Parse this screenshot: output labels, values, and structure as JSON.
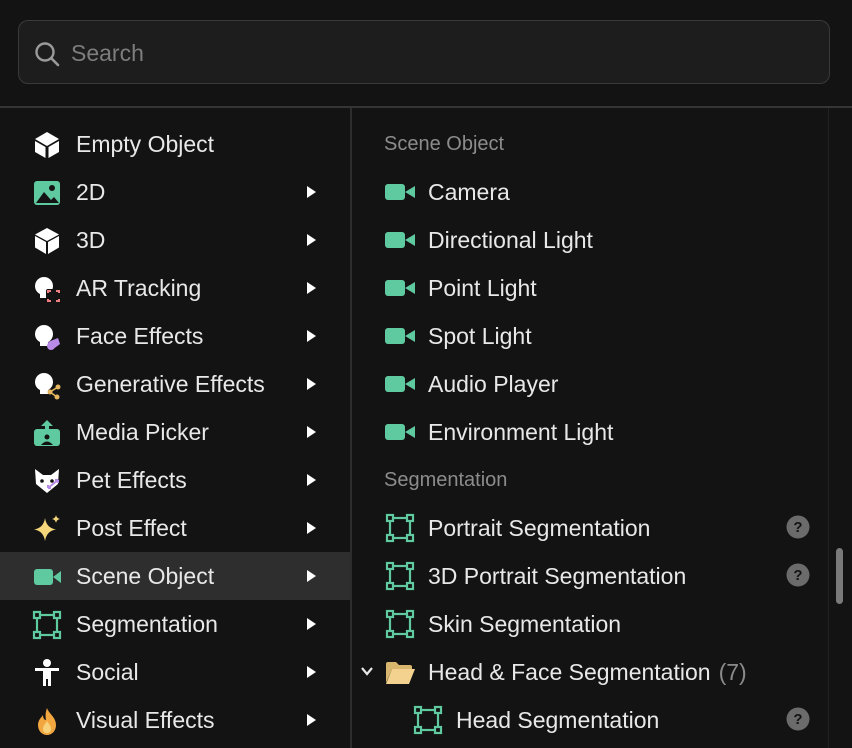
{
  "search": {
    "placeholder": "Search",
    "value": ""
  },
  "left_menu": {
    "items": [
      {
        "label": "Empty Object",
        "icon": "empty-object-icon",
        "has_submenu": false,
        "active": false
      },
      {
        "label": "2D",
        "icon": "image-icon",
        "has_submenu": true,
        "active": false
      },
      {
        "label": "3D",
        "icon": "cube-icon",
        "has_submenu": true,
        "active": false
      },
      {
        "label": "AR Tracking",
        "icon": "ar-tracking-icon",
        "has_submenu": true,
        "active": false
      },
      {
        "label": "Face Effects",
        "icon": "face-effects-icon",
        "has_submenu": true,
        "active": false
      },
      {
        "label": "Generative Effects",
        "icon": "generative-effects-icon",
        "has_submenu": true,
        "active": false
      },
      {
        "label": "Media Picker",
        "icon": "media-picker-icon",
        "has_submenu": true,
        "active": false
      },
      {
        "label": "Pet Effects",
        "icon": "pet-effects-icon",
        "has_submenu": true,
        "active": false
      },
      {
        "label": "Post Effect",
        "icon": "sparkle-icon",
        "has_submenu": true,
        "active": false
      },
      {
        "label": "Scene Object",
        "icon": "video-camera-icon",
        "has_submenu": true,
        "active": true
      },
      {
        "label": "Segmentation",
        "icon": "segmentation-icon",
        "has_submenu": true,
        "active": false
      },
      {
        "label": "Social",
        "icon": "person-icon",
        "has_submenu": true,
        "active": false
      },
      {
        "label": "Visual Effects",
        "icon": "flame-icon",
        "has_submenu": true,
        "active": false
      }
    ]
  },
  "right_panel": {
    "scene_object": {
      "header": "Scene Object",
      "items": [
        {
          "label": "Camera",
          "icon": "video-camera-icon"
        },
        {
          "label": "Directional Light",
          "icon": "video-camera-icon"
        },
        {
          "label": "Point Light",
          "icon": "video-camera-icon"
        },
        {
          "label": "Spot Light",
          "icon": "video-camera-icon"
        },
        {
          "label": "Audio Player",
          "icon": "video-camera-icon"
        },
        {
          "label": "Environment Light",
          "icon": "video-camera-icon"
        }
      ]
    },
    "segmentation": {
      "header": "Segmentation",
      "items": [
        {
          "label": "Portrait Segmentation",
          "icon": "segmentation-icon",
          "help": true
        },
        {
          "label": "3D Portrait Segmentation",
          "icon": "segmentation-icon",
          "help": true
        },
        {
          "label": "Skin Segmentation",
          "icon": "segmentation-icon",
          "help": false
        }
      ],
      "folder": {
        "label": "Head & Face Segmentation",
        "count": "(7)",
        "icon": "folder-open-icon",
        "expanded": true
      },
      "folder_items": [
        {
          "label": "Head Segmentation",
          "icon": "segmentation-icon",
          "help": true
        }
      ]
    }
  },
  "colors": {
    "accent_green": "#5fc9a0",
    "background": "#131313",
    "active_row": "#2e2e2e",
    "folder": "#f2d28e"
  }
}
